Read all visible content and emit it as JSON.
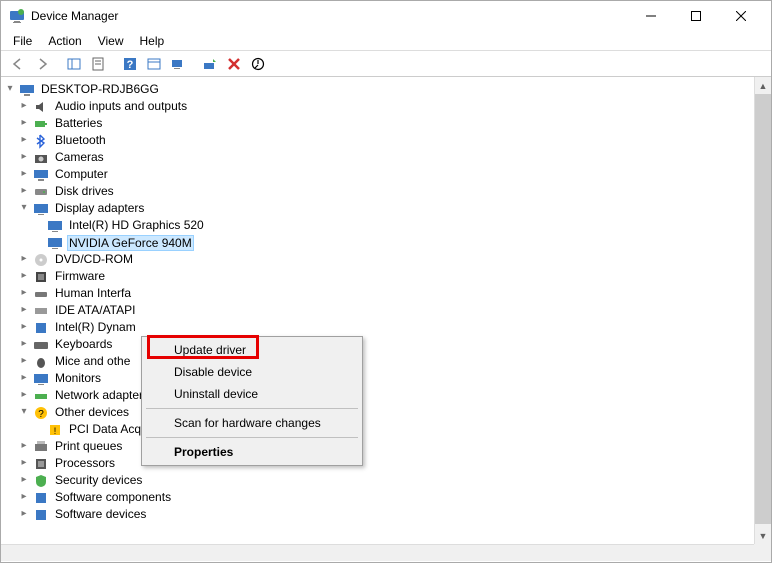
{
  "window": {
    "title": "Device Manager"
  },
  "menu": {
    "file": "File",
    "action": "Action",
    "view": "View",
    "help": "Help"
  },
  "tree": {
    "root": "DESKTOP-RDJB6GG",
    "audio": "Audio inputs and outputs",
    "batteries": "Batteries",
    "bluetooth": "Bluetooth",
    "cameras": "Cameras",
    "computer": "Computer",
    "disk": "Disk drives",
    "display": "Display adapters",
    "intel_gfx": "Intel(R) HD Graphics 520",
    "nvidia": "NVIDIA GeForce 940M",
    "dvd": "DVD/CD-ROM",
    "firmware": "Firmware",
    "hid": "Human Interfa",
    "ide": "IDE ATA/ATAPI",
    "intel_dyn": "Intel(R) Dynam",
    "keyboards": "Keyboards",
    "mice": "Mice and othe",
    "monitors": "Monitors",
    "network": "Network adapters",
    "other": "Other devices",
    "pci": "PCI Data Acquisition and Signal Processing Controller",
    "print": "Print queues",
    "processors": "Processors",
    "security": "Security devices",
    "swcomp": "Software components",
    "swdev": "Software devices"
  },
  "context": {
    "update": "Update driver",
    "disable": "Disable device",
    "uninstall": "Uninstall device",
    "scan": "Scan for hardware changes",
    "properties": "Properties"
  }
}
